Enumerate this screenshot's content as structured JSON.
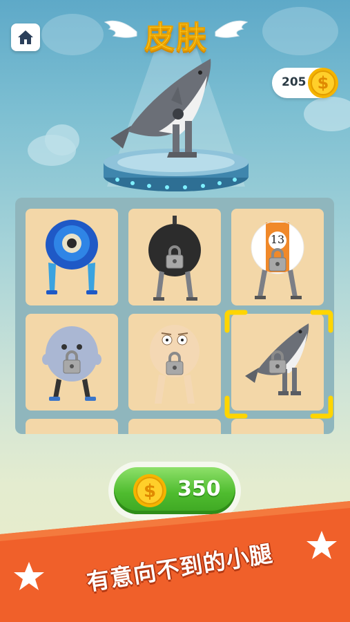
{
  "header": {
    "title": "皮肤",
    "coins": "205"
  },
  "skins": [
    {
      "name": "blue-eye-robot",
      "locked": false
    },
    {
      "name": "bomb",
      "locked": true
    },
    {
      "name": "billiard-ball-13",
      "locked": true,
      "number": "13"
    },
    {
      "name": "gray-blob",
      "locked": true
    },
    {
      "name": "bald-man",
      "locked": true
    },
    {
      "name": "shark",
      "locked": true,
      "selected": true
    }
  ],
  "buy_button": {
    "price": "350"
  },
  "banner": {
    "text": "有意向不到的小腿"
  },
  "colors": {
    "accent_gold": "#ffd12a",
    "buy_green": "#4fbc2f",
    "banner_orange": "#f0602a",
    "selection_yellow": "#ffd500"
  }
}
